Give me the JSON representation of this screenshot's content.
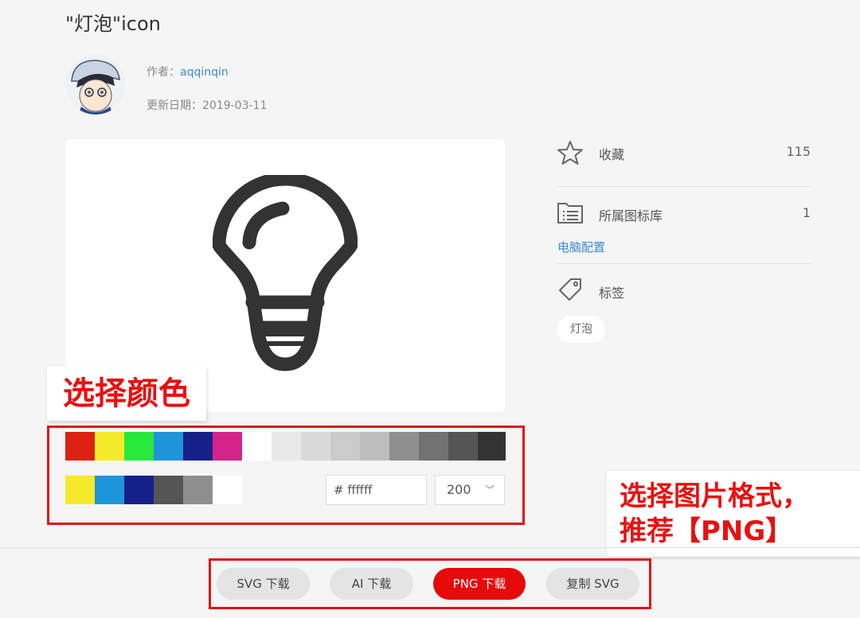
{
  "page": {
    "title": "\"灯泡\"icon"
  },
  "author": {
    "label": "作者：",
    "name": "aqqinqin"
  },
  "update": {
    "label": "更新日期：",
    "date": "2019-03-11"
  },
  "sidebar": {
    "favorite_label": "收藏",
    "favorite_count": "115",
    "library_label": "所属图标库",
    "library_count": "1",
    "library_link": "电脑配置",
    "tags_label": "标签",
    "tag": "灯泡"
  },
  "annotations": {
    "choose_color": "选择颜色",
    "choose_format_line1": "选择图片格式，",
    "choose_format_line2": "推荐【PNG】"
  },
  "palette": {
    "row1": [
      "#dd2210",
      "#f5ea2a",
      "#27e83c",
      "#1e95da",
      "#16208a",
      "#d4238a",
      "#ffffff",
      "#e8e8e8",
      "#dadada",
      "#cbcbcb",
      "#bdbdbd",
      "#8f8f8f",
      "#727272",
      "#555555",
      "#333333"
    ],
    "row2": [
      "#f5ea2a",
      "#1e95da",
      "#16208a",
      "#555555",
      "#8f8f8f",
      "#ffffff"
    ]
  },
  "color_input": {
    "value": "# ffffff"
  },
  "size_select": {
    "value": "200"
  },
  "buttons": {
    "svg": "SVG 下载",
    "ai": "AI 下载",
    "png": "PNG 下载",
    "copy": "复制 SVG"
  },
  "colors": {
    "accent": "#e60a0a",
    "link": "#3e8ad6",
    "icon": "#333333"
  }
}
